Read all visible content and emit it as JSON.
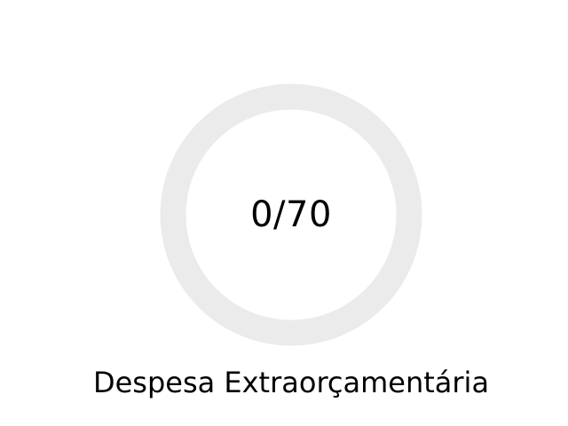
{
  "gauge": {
    "value_text": "0/70",
    "current": 0,
    "max": 70,
    "label": "Despesa Extraorçamentária"
  },
  "colors": {
    "track": "#ebebeb",
    "progress": "#4caf50",
    "text": "#000000",
    "background": "#ffffff"
  }
}
